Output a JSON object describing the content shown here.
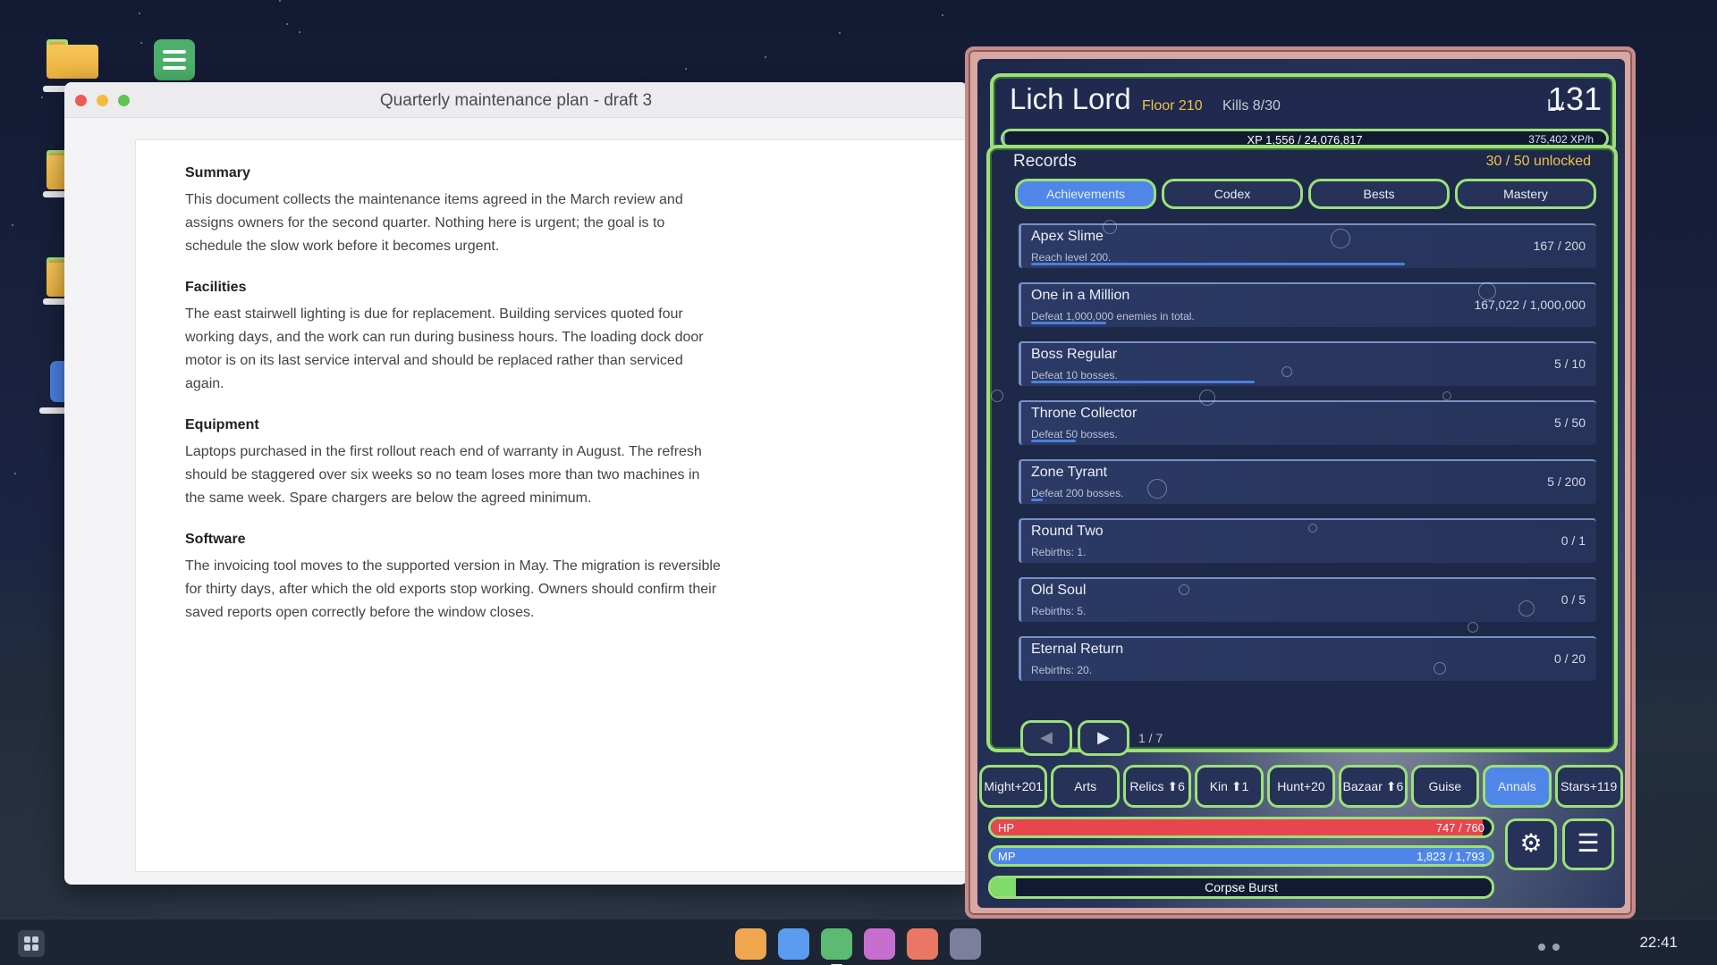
{
  "document": {
    "window_title": "Quarterly maintenance plan - draft 3",
    "sections": [
      {
        "heading": "Summary",
        "body": "This document collects the maintenance items agreed in the March review and assigns owners for the second quarter. Nothing here is urgent; the goal is to schedule the slow work before it becomes urgent."
      },
      {
        "heading": "Facilities",
        "body": "The east stairwell lighting is due for replacement. Building services quoted four working days, and the work can run during business hours. The loading dock door motor is on its last service interval and should be replaced rather than serviced again."
      },
      {
        "heading": "Equipment",
        "body": "Laptops purchased in the first rollout reach end of warranty in August. The refresh should be staggered over six weeks so no team loses more than two machines in the same week. Spare chargers are below the agreed minimum."
      },
      {
        "heading": "Software",
        "body": "The invoicing tool moves to the supported version in May. The migration is reversible for thirty days, after which the old exports stop working. Owners should confirm their saved reports open correctly before the window closes."
      }
    ]
  },
  "game": {
    "name": "Lich Lord",
    "floor": "Floor 210",
    "kills": "Kills 8/30",
    "level_label": "Lv",
    "level": "131",
    "xp_text": "XP 1,556 / 24,076,817",
    "xp_rate": "375,402 XP/h",
    "xp_fraction": 0.0001,
    "records_title": "Records",
    "records_unlocked": "30 / 50 unlocked",
    "tabs": [
      "Achievements",
      "Codex",
      "Bests",
      "Mastery"
    ],
    "active_tab": 0,
    "achievements": [
      {
        "title": "Apex Slime",
        "desc": "Reach level 200.",
        "progress": "167 / 200",
        "fraction": 0.835
      },
      {
        "title": "One in a Million",
        "desc": "Defeat 1,000,000 enemies in total.",
        "progress": "167,022 / 1,000,000",
        "fraction": 0.167
      },
      {
        "title": "Boss Regular",
        "desc": "Defeat 10 bosses.",
        "progress": "5 / 10",
        "fraction": 0.5
      },
      {
        "title": "Throne Collector",
        "desc": "Defeat 50 bosses.",
        "progress": "5 / 50",
        "fraction": 0.1
      },
      {
        "title": "Zone Tyrant",
        "desc": "Defeat 200 bosses.",
        "progress": "5 / 200",
        "fraction": 0.025
      },
      {
        "title": "Round Two",
        "desc": "Rebirths: 1.",
        "progress": "0 / 1",
        "fraction": 0
      },
      {
        "title": "Old Soul",
        "desc": "Rebirths: 5.",
        "progress": "0 / 5",
        "fraction": 0
      },
      {
        "title": "Eternal Return",
        "desc": "Rebirths: 20.",
        "progress": "0 / 20",
        "fraction": 0
      }
    ],
    "prev_icon": "◀",
    "next_icon": "▶",
    "page": "1 / 7",
    "nav": [
      "Might+201",
      "Arts",
      "Relics ⬆6",
      "Kin ⬆1",
      "Hunt+20",
      "Bazaar ⬆6",
      "Guise",
      "Annals",
      "Stars+119"
    ],
    "active_nav": 7,
    "hp_label": "HP",
    "hp_value": "747 / 760",
    "hp_fraction": 0.983,
    "mp_label": "MP",
    "mp_value": "1,823 / 1,793",
    "mp_fraction": 1.0,
    "skill_name": "Corpse Burst",
    "skill_fraction": 0.05,
    "settings_icon": "gear-icon",
    "menu_icon": "hamburger-icon",
    "colors": {
      "hp": "#e8454f",
      "mp": "#4f86e8",
      "skill": "#7fdc6a",
      "accent": "#9be07a",
      "gold": "#f1c24b"
    }
  },
  "taskbar": {
    "clock": "22:41",
    "dock_colors": [
      "#f0a64e",
      "#5b9cf0",
      "#5dba72",
      "#c76fce",
      "#e97763",
      "#7b7f9c"
    ]
  }
}
